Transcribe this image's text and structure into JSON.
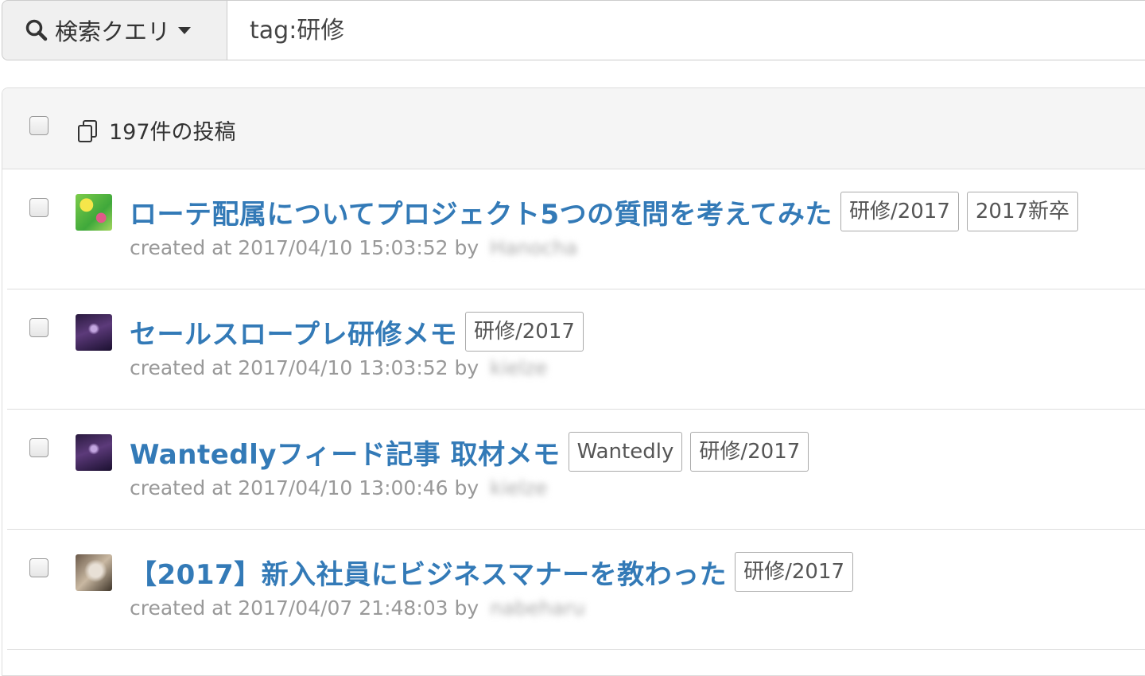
{
  "search": {
    "dropdown_label": "検索クエリ",
    "query_value": "tag:研修"
  },
  "list_header": {
    "count_label": "197件の投稿"
  },
  "posts": [
    {
      "title": "ローテ配属についてプロジェクト5つの質問を考えてみた",
      "tags": [
        "研修/2017",
        "2017新卒"
      ],
      "created_prefix": "created at 2017/04/10 15:03:52 by",
      "author": "Hanocha"
    },
    {
      "title": "セールスロープレ研修メモ",
      "tags": [
        "研修/2017"
      ],
      "created_prefix": "created at 2017/04/10 13:03:52 by",
      "author": "kielze"
    },
    {
      "title": "Wantedlyフィード記事 取材メモ",
      "tags": [
        "Wantedly",
        "研修/2017"
      ],
      "created_prefix": "created at 2017/04/10 13:00:46 by",
      "author": "kielze"
    },
    {
      "title": "【2017】新入社員にビジネスマナーを教わった",
      "tags": [
        "研修/2017"
      ],
      "created_prefix": "created at 2017/04/07 21:48:03 by",
      "author": "nabeharu"
    }
  ],
  "colors": {
    "link": "#337ab7",
    "meta": "#999999",
    "header_bg": "#f5f5f5"
  }
}
